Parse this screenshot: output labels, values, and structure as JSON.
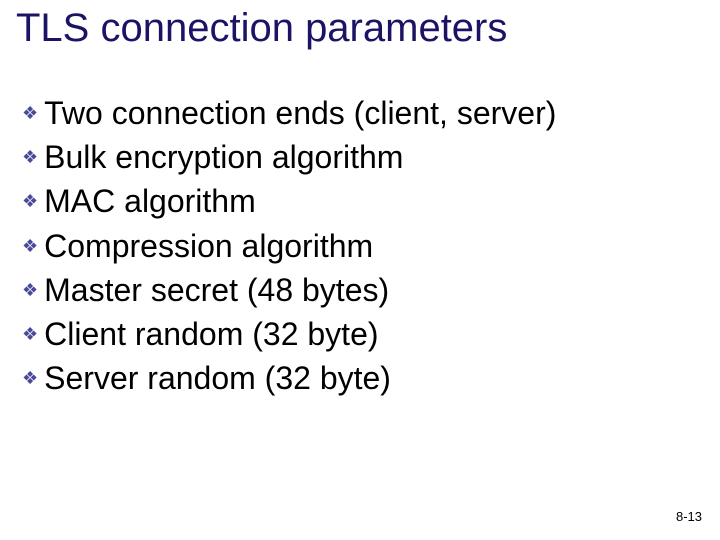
{
  "title": "TLS connection parameters",
  "bullets": [
    "Two connection ends (client, server)",
    "Bulk encryption algorithm",
    "MAC algorithm",
    "Compression algorithm",
    "Master secret (48 bytes)",
    "Client random (32 byte)",
    "Server random (32 byte)"
  ],
  "bullet_glyph": "❖",
  "page_number": "8-13"
}
